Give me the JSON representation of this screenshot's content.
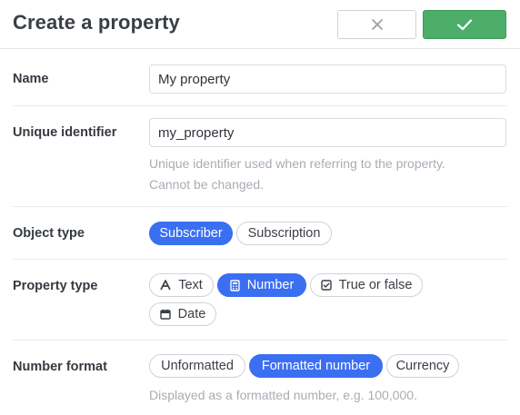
{
  "header": {
    "title": "Create a property"
  },
  "fields": {
    "name": {
      "label": "Name",
      "value": "My property"
    },
    "identifier": {
      "label": "Unique identifier",
      "value": "my_property",
      "hint_line1": "Unique identifier used when referring to the property.",
      "hint_line2": "Cannot be changed."
    },
    "object_type": {
      "label": "Object type",
      "options": [
        "Subscriber",
        "Subscription"
      ],
      "selected": "Subscriber"
    },
    "property_type": {
      "label": "Property type",
      "options": [
        "Text",
        "Number",
        "True or false",
        "Date"
      ],
      "selected": "Number"
    },
    "number_format": {
      "label": "Number format",
      "options": [
        "Unformatted",
        "Formatted number",
        "Currency"
      ],
      "selected": "Formatted number",
      "hint": "Displayed as a formatted number, e.g. 100,000."
    }
  },
  "colors": {
    "accent": "#3b6ff2",
    "confirm": "#4cae68"
  }
}
